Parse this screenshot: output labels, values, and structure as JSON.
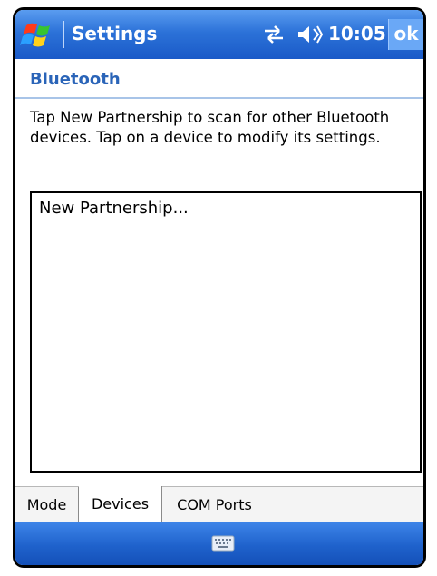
{
  "titlebar": {
    "title": "Settings",
    "time": "10:05",
    "ok_label": "ok",
    "icons": [
      "windows-start-icon",
      "connectivity-icon",
      "volume-icon"
    ]
  },
  "page": {
    "heading": "Bluetooth",
    "instructions": "Tap New Partnership to scan for other Bluetooth devices. Tap on a device to modify its settings."
  },
  "devices_list": {
    "items": [
      "New Partnership..."
    ]
  },
  "tabs": [
    {
      "label": "Mode",
      "active": false
    },
    {
      "label": "Devices",
      "active": true
    },
    {
      "label": "COM Ports",
      "active": false
    }
  ],
  "menubar": {
    "icon": "keyboard-icon"
  },
  "colors": {
    "titlebar": "#2c72d8",
    "heading_text": "#2a64b8",
    "menubar": "#1f62cc"
  }
}
